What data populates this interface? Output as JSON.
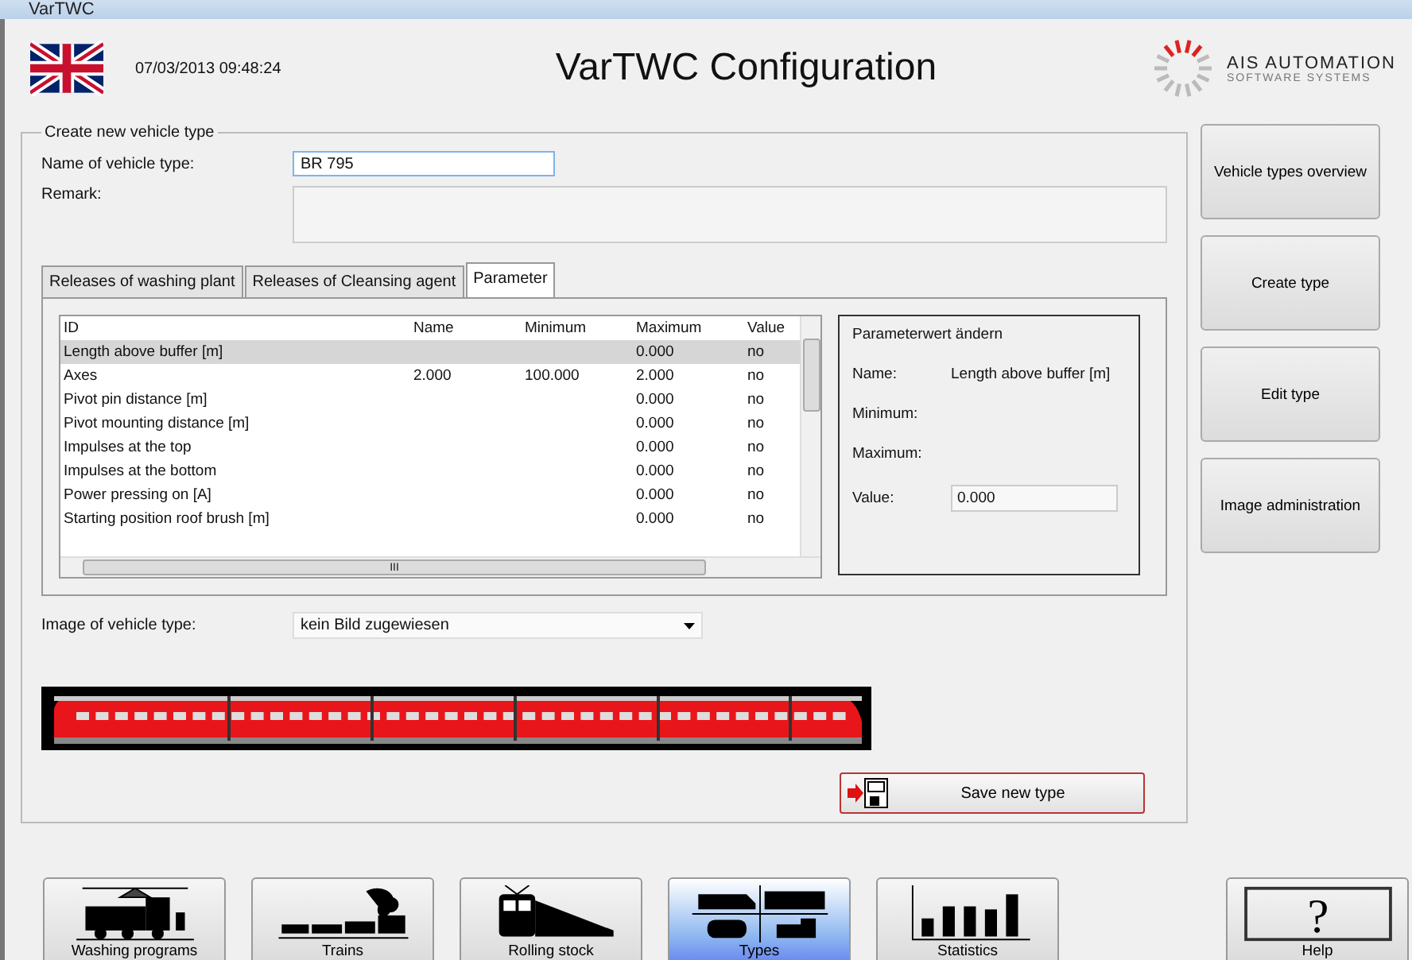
{
  "window": {
    "title": "VarTWC"
  },
  "header": {
    "datetime": "07/03/2013 09:48:24",
    "title": "VarTWC Configuration",
    "company": "AIS AUTOMATION",
    "company_sub": "SOFTWARE SYSTEMS"
  },
  "group": {
    "title": "Create new vehicle type",
    "name_label": "Name of vehicle type:",
    "name_value": "BR 795",
    "remark_label": "Remark:",
    "tabs": [
      {
        "label": "Releases of washing plant",
        "selected": false
      },
      {
        "label": "Releases of Cleansing agent",
        "selected": false
      },
      {
        "label": "Parameter",
        "selected": true
      }
    ],
    "table": {
      "columns": [
        "ID",
        "Name",
        "Minimum",
        "Maximum",
        "Value"
      ],
      "rows": [
        {
          "cells": [
            "Length above buffer [m]",
            "",
            "",
            "0.000",
            "no"
          ],
          "selected": true
        },
        {
          "cells": [
            "Axes",
            "2.000",
            "100.000",
            "2.000",
            "no"
          ],
          "selected": false
        },
        {
          "cells": [
            "Pivot pin distance [m]",
            "",
            "",
            "0.000",
            "no"
          ],
          "selected": false
        },
        {
          "cells": [
            "Pivot mounting distance [m]",
            "",
            "",
            "0.000",
            "no"
          ],
          "selected": false
        },
        {
          "cells": [
            "Impulses at the top",
            "",
            "",
            "0.000",
            "no"
          ],
          "selected": false
        },
        {
          "cells": [
            "Impulses at the bottom",
            "",
            "",
            "0.000",
            "no"
          ],
          "selected": false
        },
        {
          "cells": [
            "Power pressing on [A]",
            "",
            "",
            "0.000",
            "no"
          ],
          "selected": false
        },
        {
          "cells": [
            "Starting position roof brush [m]",
            "",
            "",
            "0.000",
            "no"
          ],
          "selected": false
        }
      ],
      "hscroll_grip": "III"
    },
    "param_panel": {
      "title": "Parameterwert ändern",
      "name_label": "Name:",
      "name_value": "Length above buffer [m]",
      "minimum_label": "Minimum:",
      "maximum_label": "Maximum:",
      "value_label": "Value:",
      "value": "0.000"
    },
    "image_label": "Image of vehicle type:",
    "image_select": "kein Bild zugewiesen",
    "save_button": "Save new type"
  },
  "side_buttons": [
    "Vehicle types overview",
    "Create type",
    "Edit type",
    "Image administration"
  ],
  "nav": [
    {
      "label": "Washing programs",
      "selected": false
    },
    {
      "label": "Trains",
      "selected": false
    },
    {
      "label": "Rolling stock",
      "selected": false
    },
    {
      "label": "Types",
      "selected": true
    },
    {
      "label": "Statistics",
      "selected": false
    },
    {
      "label": "Help",
      "selected": false
    }
  ],
  "help_glyph": "?"
}
